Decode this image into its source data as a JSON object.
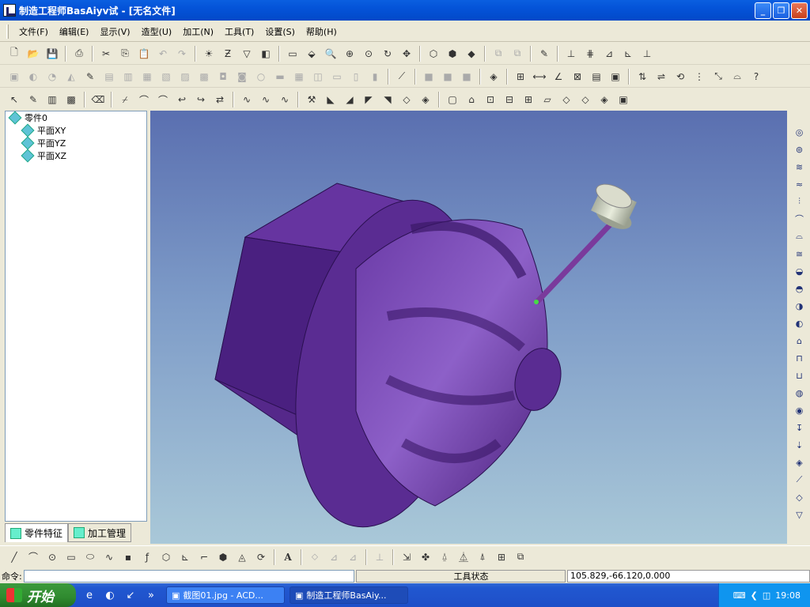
{
  "window": {
    "title": "制造工程师BasAiyv试  - [无名文件]",
    "controls": [
      "minimize",
      "restore",
      "close"
    ]
  },
  "menu": [
    {
      "label": "文件(F)"
    },
    {
      "label": "编辑(E)"
    },
    {
      "label": "显示(V)"
    },
    {
      "label": "造型(U)"
    },
    {
      "label": "加工(N)"
    },
    {
      "label": "工具(T)"
    },
    {
      "label": "设置(S)"
    },
    {
      "label": "帮助(H)"
    }
  ],
  "toolbar1": {
    "icons": [
      "new-file-icon",
      "open-file-icon",
      "save-icon",
      "print-icon",
      "cut-icon",
      "copy-icon",
      "paste-icon",
      "undo-icon",
      "redo-icon",
      "light-icon",
      "filter-icon",
      "funnel-icon",
      "layer-icon",
      "view-icon",
      "zoom-window-icon",
      "zoom-icon",
      "zoom-in-icon",
      "zoom-fit-icon",
      "rotate-icon",
      "pan-icon",
      "wireframe-icon",
      "hidden-line-icon",
      "shaded-icon",
      "copy-view-icon",
      "paste-view-icon",
      "tool-icon",
      "axis-icon",
      "axis-2-icon",
      "axis-3-icon",
      "axis-4-icon",
      "axis-5-icon"
    ]
  },
  "toolbar3": {
    "icons": [
      "select-icon",
      "pen-icon",
      "layer-color-icon",
      "color-icon",
      "eraser-icon"
    ]
  },
  "tree": {
    "root": "零件0",
    "children": [
      "平面XY",
      "平面YZ",
      "平面XZ"
    ]
  },
  "tabs": [
    {
      "label": "零件特征",
      "active": true
    },
    {
      "label": "加工管理",
      "active": false
    }
  ],
  "viewport": {
    "model_color": "#5b2d8c",
    "tool_holder_color": "#c8c8b8"
  },
  "status": {
    "command_label": "命令:",
    "state": "工具状态",
    "coordinates": "105.829,-66.120,0.000"
  },
  "taskbar": {
    "start": "开始",
    "tasks": [
      {
        "label": "截图01.jpg - ACD...",
        "active": false
      },
      {
        "label": "制造工程师BasAiy...",
        "active": true
      }
    ],
    "time": "19:08"
  }
}
